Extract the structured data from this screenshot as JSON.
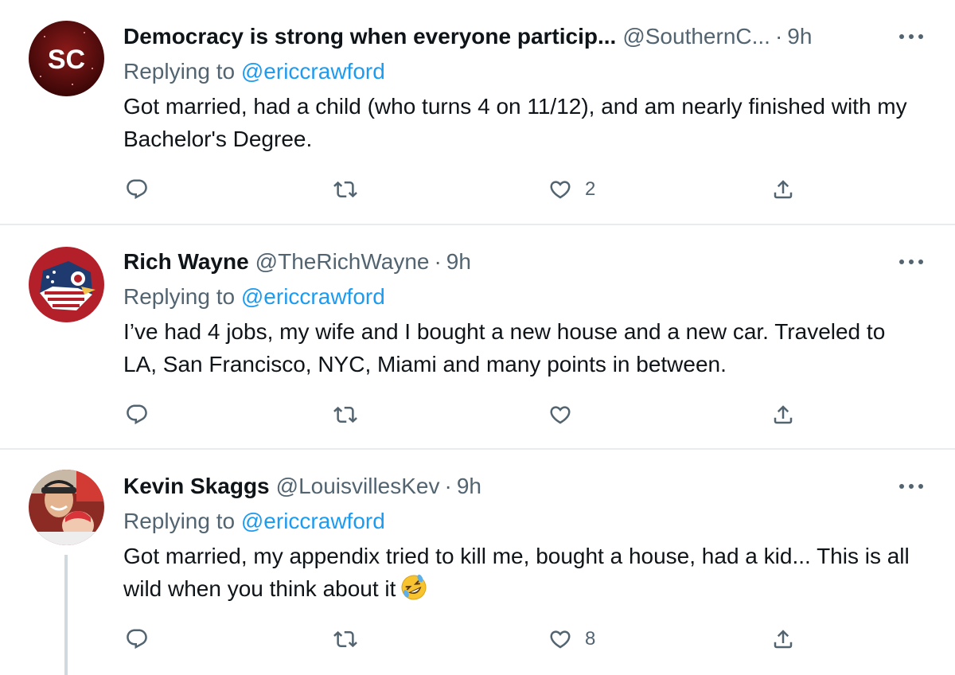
{
  "tweets": [
    {
      "avatar": "sc-logo-avatar",
      "name": "Democracy is strong when everyone particip...",
      "handle": "@SouthernC...",
      "time": "9h",
      "reply_prefix": "Replying to",
      "reply_to": "@ericcrawford",
      "text": "Got married, had a child (who turns 4 on 11/12), and am nearly finished with my Bachelor's Degree.",
      "likes": "2"
    },
    {
      "avatar": "cardinal-flag-avatar",
      "name": "Rich Wayne",
      "handle": "@TheRichWayne",
      "time": "9h",
      "reply_prefix": "Replying to",
      "reply_to": "@ericcrawford",
      "text": "I’ve had 4 jobs, my wife and I bought a new house and a new car. Traveled to LA, San Francisco, NYC, Miami and many points in between.",
      "likes": ""
    },
    {
      "avatar": "photo-avatar",
      "name": "Kevin Skaggs",
      "handle": "@LouisvillesKev",
      "time": "9h",
      "reply_prefix": "Replying to",
      "reply_to": "@ericcrawford",
      "text": "Got married, my appendix tried to kill me, bought a house, had a kid... This is all wild when you think about it",
      "emoji": "rolling-on-floor-laughing-emoji",
      "likes": "8"
    }
  ],
  "colors": {
    "link": "#1d9bf0",
    "secondary_text": "#536471",
    "primary_text": "#0f1419",
    "divider": "#e8ecef"
  }
}
